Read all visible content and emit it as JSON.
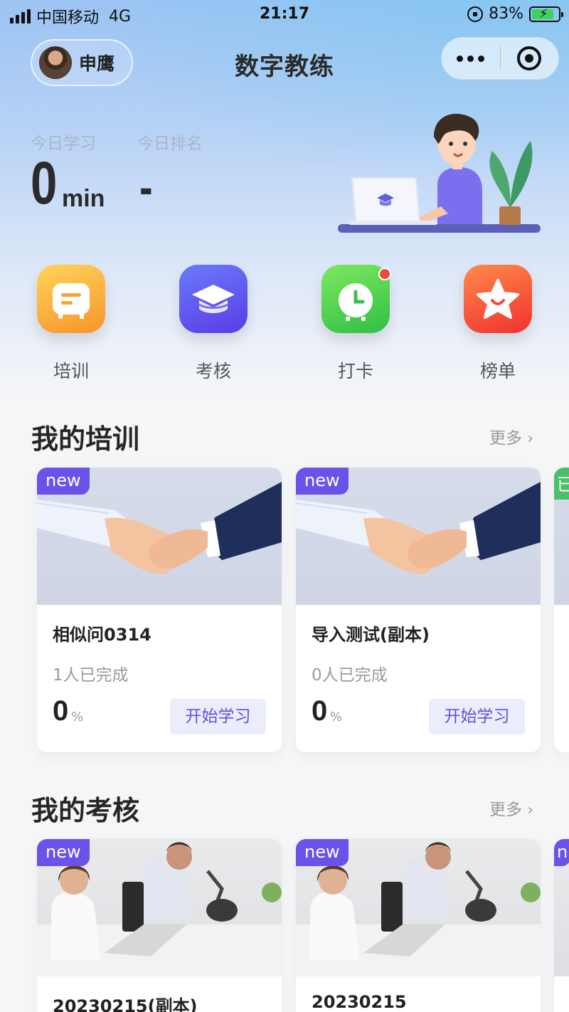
{
  "status_bar": {
    "carrier": "中国移动",
    "network": "4G",
    "time": "21:17",
    "battery": "83%",
    "battery_level": 0.83
  },
  "header": {
    "user_name": "申鹰",
    "title": "数字教练"
  },
  "stats": {
    "study_label": "今日学习",
    "study_value": "0",
    "study_unit": "min",
    "rank_label": "今日排名",
    "rank_value": "-"
  },
  "quick_menu": [
    {
      "label": "培训",
      "icon": "training-icon",
      "color": "#f9a531"
    },
    {
      "label": "考核",
      "icon": "graduation-cap-icon",
      "color": "#5b4ef0"
    },
    {
      "label": "打卡",
      "icon": "clock-icon",
      "color": "#48c94b"
    },
    {
      "label": "榜单",
      "icon": "star-icon",
      "color": "#f6503a"
    }
  ],
  "training_section": {
    "title": "我的培训",
    "more": "更多",
    "cards": [
      {
        "badge": "new",
        "title": "相似问0314",
        "completed": "1人已完成",
        "percent": "0",
        "percent_unit": "%",
        "button": "开始学习"
      },
      {
        "badge": "new",
        "title": "导入测试(副本)",
        "completed": "0人已完成",
        "percent": "0",
        "percent_unit": "%",
        "button": "开始学习"
      },
      {
        "badge": "已"
      }
    ]
  },
  "exam_section": {
    "title": "我的考核",
    "more": "更多",
    "cards": [
      {
        "badge": "new",
        "title": "20230215(副本)"
      },
      {
        "badge": "new",
        "title": "20230215"
      },
      {
        "badge": "n"
      }
    ]
  }
}
